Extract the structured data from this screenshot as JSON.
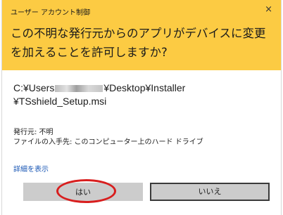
{
  "dialog": {
    "window_title": "ユーザー アカウント制御",
    "close_glyph": "×",
    "question": "この不明な発行元からのアプリがデバイスに変更を加えることを許可しますか?",
    "path_part1": "C:¥Users",
    "path_part2": "¥Desktop¥Installer",
    "path_line2": "¥TSshield_Setup.msi",
    "publisher": "発行元: 不明",
    "origin": "ファイルの入手先: このコンピューター上のハード ドライブ",
    "details_link": "詳細を表示",
    "yes_label": "はい",
    "no_label": "いいえ"
  },
  "colors": {
    "header_background": "#fccb43",
    "button_background": "#cccccc",
    "link": "#1a57b5",
    "annotation_circle": "#d81e1e"
  },
  "icons": {
    "close": "close-icon"
  }
}
